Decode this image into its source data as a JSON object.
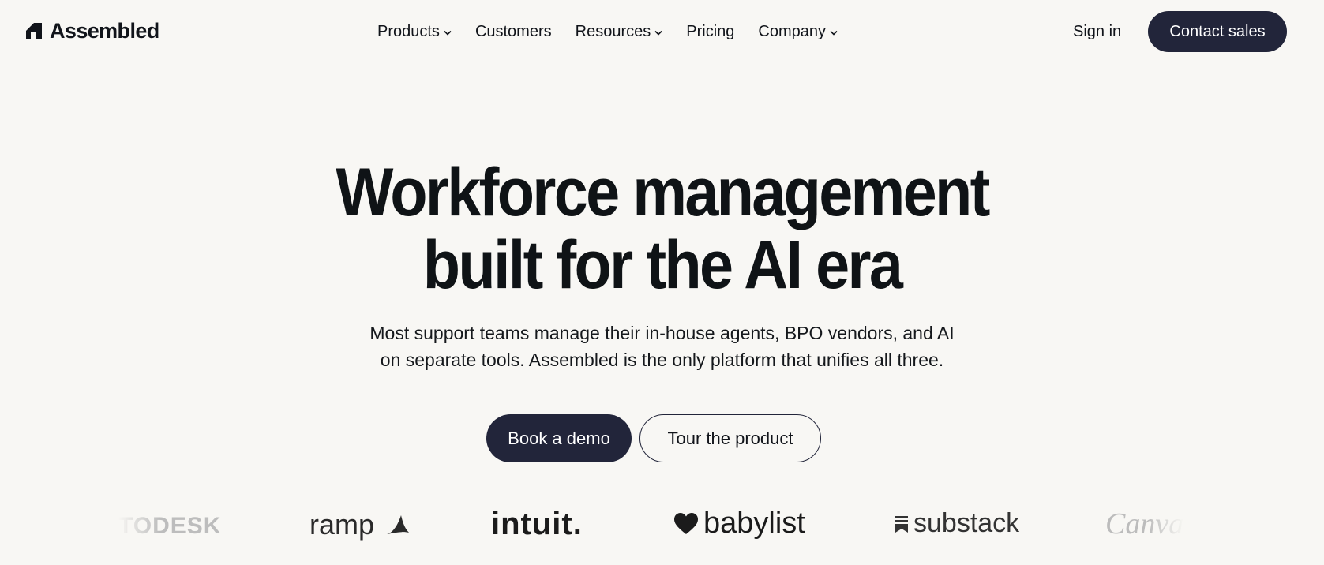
{
  "header": {
    "logo_text": "Assembled",
    "nav": [
      {
        "label": "Products",
        "has_dropdown": true
      },
      {
        "label": "Customers",
        "has_dropdown": false
      },
      {
        "label": "Resources",
        "has_dropdown": true
      },
      {
        "label": "Pricing",
        "has_dropdown": false
      },
      {
        "label": "Company",
        "has_dropdown": true
      }
    ],
    "sign_in": "Sign in",
    "contact_sales": "Contact sales"
  },
  "hero": {
    "title_line1": "Workforce management",
    "title_line2": "built for the AI era",
    "subtitle_line1": "Most support teams manage their in-house agents, BPO vendors, and AI",
    "subtitle_line2": "on separate tools. Assembled is the only platform that unifies all three.",
    "primary_cta": "Book a demo",
    "secondary_cta": "Tour the product"
  },
  "customer_logos": [
    {
      "name": "autodesk",
      "text": "TODESK"
    },
    {
      "name": "ramp",
      "text": "ramp"
    },
    {
      "name": "intuit",
      "text": "intuit."
    },
    {
      "name": "babylist",
      "text": "babylist"
    },
    {
      "name": "substack",
      "text": "substack"
    },
    {
      "name": "canva",
      "text": "Canva"
    }
  ],
  "colors": {
    "background": "#f8f7f4",
    "primary_button": "#22253a",
    "text": "#11141a"
  }
}
